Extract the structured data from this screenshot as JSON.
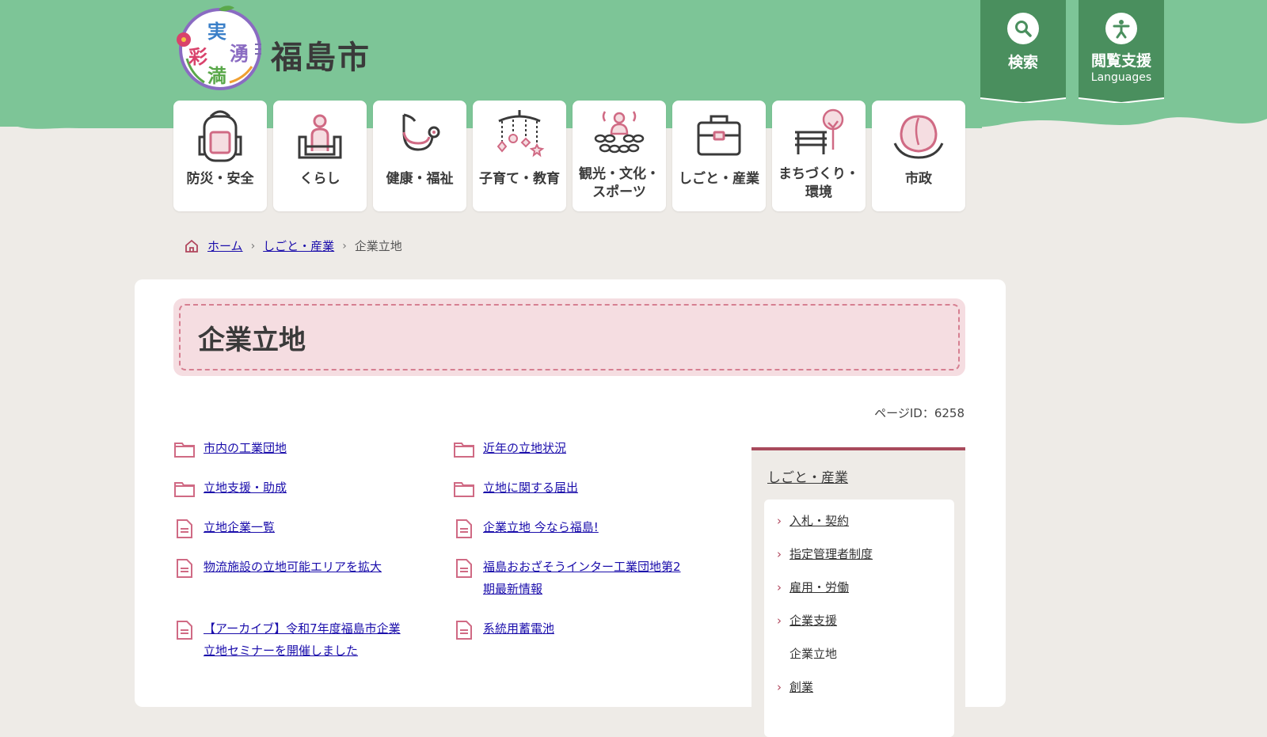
{
  "site": {
    "name": "福島市",
    "logo_text_1": "実",
    "logo_text_2": "彩",
    "logo_text_3": "湧",
    "logo_text_4": "満"
  },
  "tools": {
    "search_label": "検索",
    "access_label": "閲覧支援",
    "access_sub": "Languages"
  },
  "nav": [
    {
      "label": "防災・安全",
      "icon": "backpack-icon"
    },
    {
      "label": "くらし",
      "icon": "person-sofa-icon"
    },
    {
      "label": "健康・福祉",
      "icon": "stethoscope-icon"
    },
    {
      "label": "子育て・教育",
      "icon": "mobile-toy-icon"
    },
    {
      "label": "観光・文化・\nスポーツ",
      "icon": "hot-spring-icon"
    },
    {
      "label": "しごと・産業",
      "icon": "toolbox-icon"
    },
    {
      "label": "まちづくり・\n環境",
      "icon": "bench-tree-icon"
    },
    {
      "label": "市政",
      "icon": "peach-icon"
    }
  ],
  "breadcrumb": {
    "home": "ホーム",
    "parent": "しごと・産業",
    "current": "企業立地",
    "sep": "›"
  },
  "page": {
    "title": "企業立地",
    "page_id": "ページID：6258"
  },
  "links": {
    "left": [
      {
        "text": "市内の工業団地",
        "type": "folder-icon"
      },
      {
        "text": "立地支援・助成",
        "type": "folder-icon"
      },
      {
        "text": "立地企業一覧",
        "type": "document-icon"
      },
      {
        "text": "物流施設の立地可能エリアを拡大",
        "type": "document-icon"
      },
      {
        "text": "【アーカイブ】令和7年度福島市企業立地セミナーを開催しました",
        "type": "document-icon"
      }
    ],
    "right": [
      {
        "text": "近年の立地状況",
        "type": "folder-icon"
      },
      {
        "text": "立地に関する届出",
        "type": "folder-icon"
      },
      {
        "text": "企業立地 今なら福島!",
        "type": "document-icon"
      },
      {
        "text": "福島おおざそうインター工業団地第2期最新情報",
        "type": "document-icon"
      },
      {
        "text": "系統用蓄電池",
        "type": "document-icon"
      }
    ]
  },
  "sidebar": {
    "title": "しごと・産業",
    "items": [
      {
        "label": "入札・契約",
        "link": true
      },
      {
        "label": "指定管理者制度",
        "link": true
      },
      {
        "label": "雇用・労働",
        "link": true
      },
      {
        "label": "企業支援",
        "link": true
      },
      {
        "label": "企業立地",
        "link": false
      },
      {
        "label": "創業",
        "link": true
      }
    ]
  },
  "colors": {
    "header_green": "#7dc597",
    "dark_green": "#4a8f5e",
    "accent_pink": "#d06a84",
    "sidebar_border": "#a84a5c"
  }
}
